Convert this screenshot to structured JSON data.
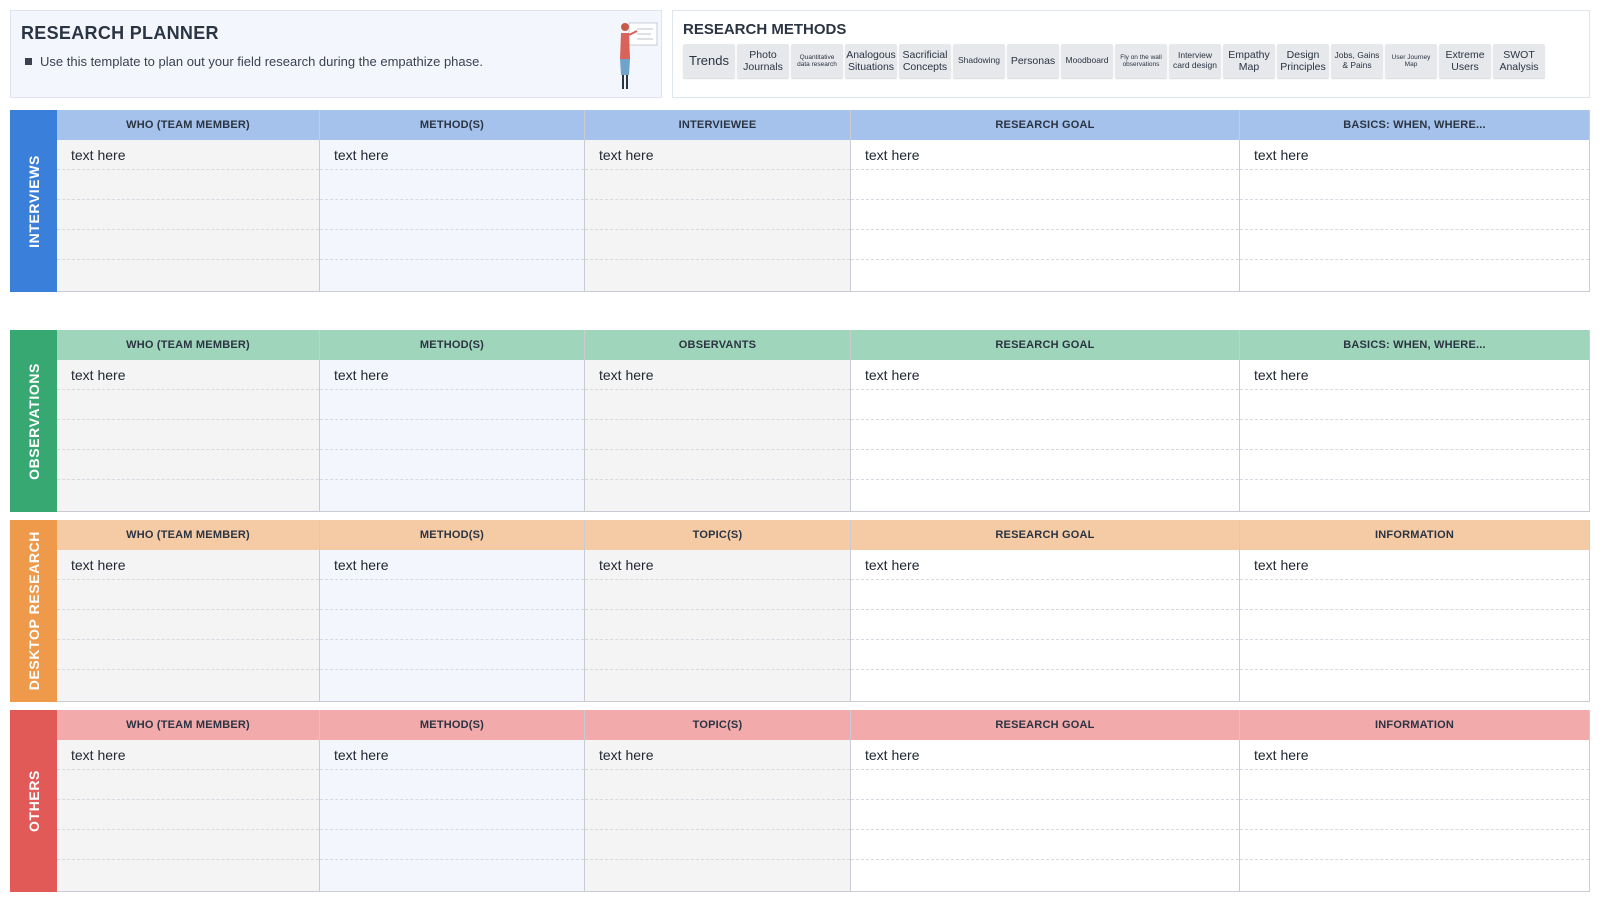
{
  "header": {
    "title": "RESEARCH PLANNER",
    "description": "Use this template to plan out your field research during the empathize phase."
  },
  "methods_panel": {
    "title": "RESEARCH METHODS",
    "chips": [
      {
        "label": "Trends",
        "size": "xl",
        "w": 52
      },
      {
        "label": "Photo Journals",
        "size": "md",
        "w": 52
      },
      {
        "label": "Quantitative data research",
        "size": "xs",
        "w": 52
      },
      {
        "label": "Analogous Situations",
        "size": "md",
        "w": 52
      },
      {
        "label": "Sacrificial Concepts",
        "size": "md",
        "w": 52
      },
      {
        "label": "Shadowing",
        "size": "sm",
        "w": 52
      },
      {
        "label": "Personas",
        "size": "md",
        "w": 52
      },
      {
        "label": "Moodboard",
        "size": "sm",
        "w": 52
      },
      {
        "label": "Fly on the wall observations",
        "size": "xs",
        "w": 52
      },
      {
        "label": "Interview card design",
        "size": "sm",
        "w": 52
      },
      {
        "label": "Empathy Map",
        "size": "md",
        "w": 52
      },
      {
        "label": "Design Principles",
        "size": "md",
        "w": 52
      },
      {
        "label": "Jobs, Gains & Pains",
        "size": "sm",
        "w": 52
      },
      {
        "label": "User Journey Map",
        "size": "xs",
        "w": 52
      },
      {
        "label": "Extreme Users",
        "size": "md",
        "w": 52
      },
      {
        "label": "SWOT Analysis",
        "size": "md",
        "w": 52
      }
    ]
  },
  "sections": [
    {
      "label": "INTERVIEWS",
      "color": "#3a7fd9",
      "header_color": "#a4c2ec",
      "columns": [
        "WHO (TEAM MEMBER)",
        "METHOD(S)",
        "INTERVIEWEE",
        "RESEARCH GOAL",
        "BASICS: WHEN, WHERE..."
      ],
      "cell_text": "text here"
    },
    {
      "label": "OBSERVATIONS",
      "color": "#38a872",
      "header_color": "#9fd5ba",
      "columns": [
        "WHO (TEAM MEMBER)",
        "METHOD(S)",
        "OBSERVANTS",
        "RESEARCH GOAL",
        "BASICS: WHEN, WHERE..."
      ],
      "cell_text": "text here"
    },
    {
      "label": "DESKTOP RESEARCH",
      "color": "#ef9a4a",
      "header_color": "#f5cba5",
      "columns": [
        "WHO (TEAM MEMBER)",
        "METHOD(S)",
        "TOPIC(S)",
        "RESEARCH GOAL",
        "INFORMATION"
      ],
      "cell_text": "text here"
    },
    {
      "label": "OTHERS",
      "color": "#e25a58",
      "header_color": "#f2aaaa",
      "columns": [
        "WHO (TEAM MEMBER)",
        "METHOD(S)",
        "TOPIC(S)",
        "RESEARCH GOAL",
        "INFORMATION"
      ],
      "cell_text": "text here"
    }
  ]
}
